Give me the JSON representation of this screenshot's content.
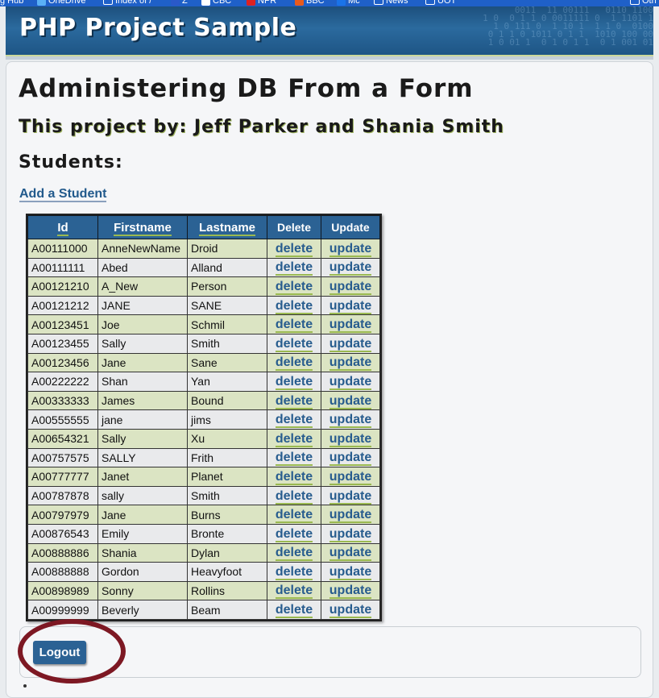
{
  "bookmarks": [
    {
      "label": "g Hub",
      "icon": "bookmark-icon"
    },
    {
      "label": "OneDrive",
      "icon": "onedrive-icon"
    },
    {
      "label": "Index of /",
      "icon": "folder-icon"
    },
    {
      "label": "Z",
      "icon": "z-icon"
    },
    {
      "label": "CBC",
      "icon": "cbc-icon"
    },
    {
      "label": "NPR",
      "icon": "npr-icon"
    },
    {
      "label": "BBC",
      "icon": "bbc-icon"
    },
    {
      "label": "Mc",
      "icon": "mc-icon"
    },
    {
      "label": "News",
      "icon": "folder-icon"
    },
    {
      "label": "UOT",
      "icon": "folder-icon"
    },
    {
      "label": "Oth",
      "icon": "folder-icon"
    }
  ],
  "header": {
    "site_title": "PHP Project Sample",
    "binary_pattern": "0011  11 00111   0110 1100\n1 0  0 1 1 0 0011111 0  1 1101 1\n 1 0 111 0  1 10 1  1 1 0  0100\n0 1 1 0 1011 0 1 1  1010 100 00\n 1 0 01 1  0 1 0 1 1  0 1 001 01"
  },
  "page": {
    "heading": "Administering DB From a Form",
    "byline": "This project by: Jeff Parker and Shania Smith",
    "section_title": "Students:",
    "add_student_link": "Add a Student"
  },
  "table": {
    "headers": {
      "id": "Id",
      "firstname": "Firstname",
      "lastname": "Lastname",
      "delete": "Delete",
      "update": "Update"
    },
    "delete_label": "delete",
    "update_label": "update",
    "rows": [
      {
        "id": "A00111000",
        "first": "AnneNewName",
        "last": "Droid"
      },
      {
        "id": "A00111111",
        "first": "Abed",
        "last": "Alland"
      },
      {
        "id": "A00121210",
        "first": "A_New",
        "last": "Person"
      },
      {
        "id": "A00121212",
        "first": "JANE",
        "last": "SANE"
      },
      {
        "id": "A00123451",
        "first": "Joe",
        "last": "Schmil"
      },
      {
        "id": "A00123455",
        "first": "Sally",
        "last": "Smith"
      },
      {
        "id": "A00123456",
        "first": "Jane",
        "last": "Sane"
      },
      {
        "id": "A00222222",
        "first": "Shan",
        "last": "Yan"
      },
      {
        "id": "A00333333",
        "first": "James",
        "last": "Bound"
      },
      {
        "id": "A00555555",
        "first": "jane",
        "last": "jims"
      },
      {
        "id": "A00654321",
        "first": "Sally",
        "last": "Xu"
      },
      {
        "id": "A00757575",
        "first": "SALLY",
        "last": "Frith"
      },
      {
        "id": "A00777777",
        "first": "Janet",
        "last": "Planet"
      },
      {
        "id": "A00787878",
        "first": "sally",
        "last": "Smith"
      },
      {
        "id": "A00797979",
        "first": "Jane",
        "last": "Burns"
      },
      {
        "id": "A00876543",
        "first": "Emily",
        "last": "Bronte"
      },
      {
        "id": "A00888886",
        "first": "Shania",
        "last": "Dylan"
      },
      {
        "id": "A00888888",
        "first": "Gordon",
        "last": "Heavyfoot"
      },
      {
        "id": "A00898989",
        "first": "Sonny",
        "last": "Rollins"
      },
      {
        "id": "A00999999",
        "first": "Beverly",
        "last": "Beam"
      }
    ]
  },
  "footer": {
    "logout_label": "Logout"
  },
  "colors": {
    "header_blue": "#2b6294",
    "link_blue": "#275c8e",
    "accent_green": "#9ab950",
    "row_green": "#dbe4c3",
    "row_gray": "#e9eaec",
    "annotation_circle": "#7d1823"
  }
}
